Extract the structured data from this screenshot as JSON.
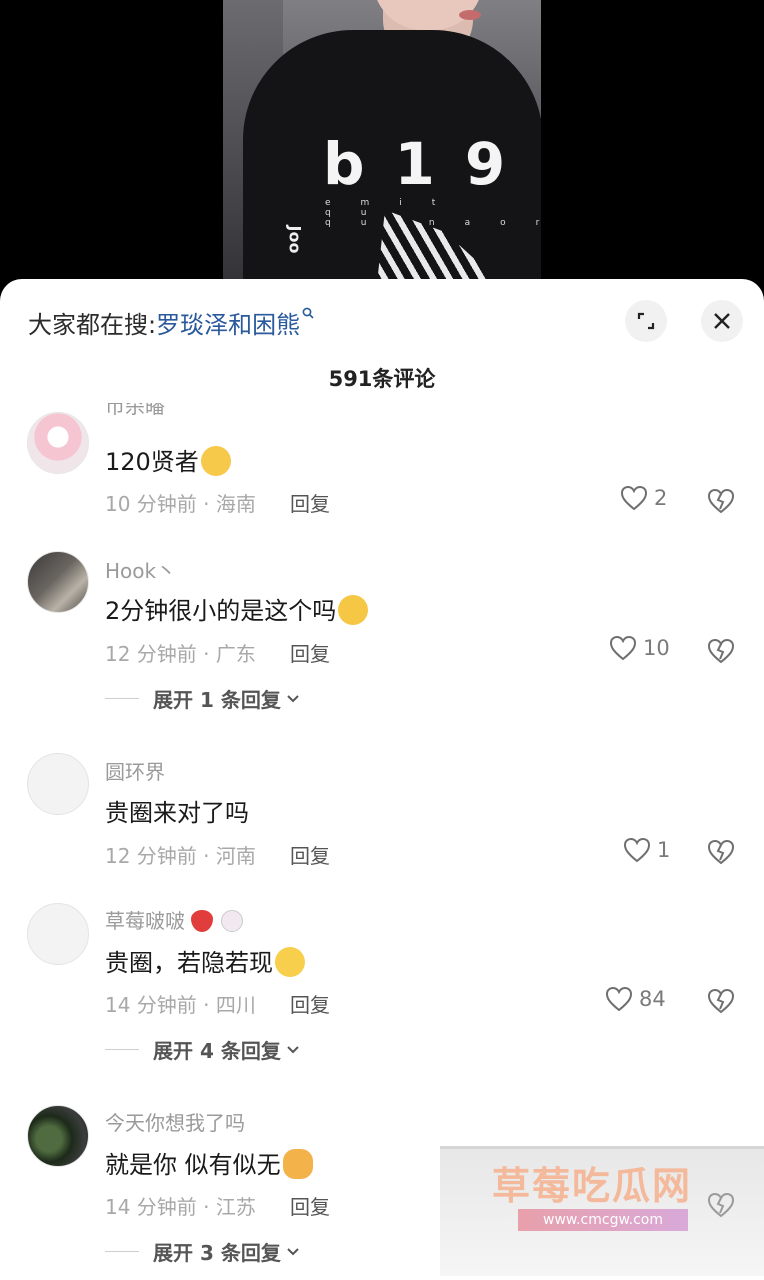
{
  "search": {
    "prefix": "大家都在搜:",
    "term": "罗琰泽和困熊"
  },
  "comments_header": {
    "count_label": "591条评论"
  },
  "video": {
    "shirt_text": "b19",
    "shirt_sub": "emit qu quinaorth",
    "sleeve_text": "Joo"
  },
  "comments": [
    {
      "username": "币杀皤",
      "text": "120贤者",
      "emoji": "dizzy-face-emoji",
      "meta": "10 分钟前 · 海南",
      "reply": "回复",
      "likes": "2"
    },
    {
      "username": "Hook丶",
      "text": "2分钟很小的是这个吗",
      "emoji": "thinking-face-emoji",
      "meta": "12 分钟前 · 广东",
      "reply": "回复",
      "likes": "10",
      "expand": "展开 1 条回复"
    },
    {
      "username": "圆环界",
      "text": "贵圈来对了吗",
      "meta": "12 分钟前 · 河南",
      "reply": "回复",
      "likes": "1"
    },
    {
      "username": "草莓啵啵",
      "text": "贵圈，若隐若现",
      "emoji": "laughing-face-emoji",
      "meta": "14 分钟前 · 四川",
      "reply": "回复",
      "likes": "84",
      "expand": "展开 4 条回复"
    },
    {
      "username": "今天你想我了吗",
      "text": "就是你 似有似无",
      "emoji": "dog-face-emoji",
      "meta": "14 分钟前 · 江苏",
      "reply": "回复",
      "expand": "展开 3 条回复"
    }
  ],
  "watermark": {
    "title": "草莓吃瓜网",
    "url": "www.cmcgw.com"
  },
  "colors": {
    "link": "#2a5a9c",
    "sheet_bg": "#ffffff",
    "meta_text": "#a8a8a8"
  }
}
